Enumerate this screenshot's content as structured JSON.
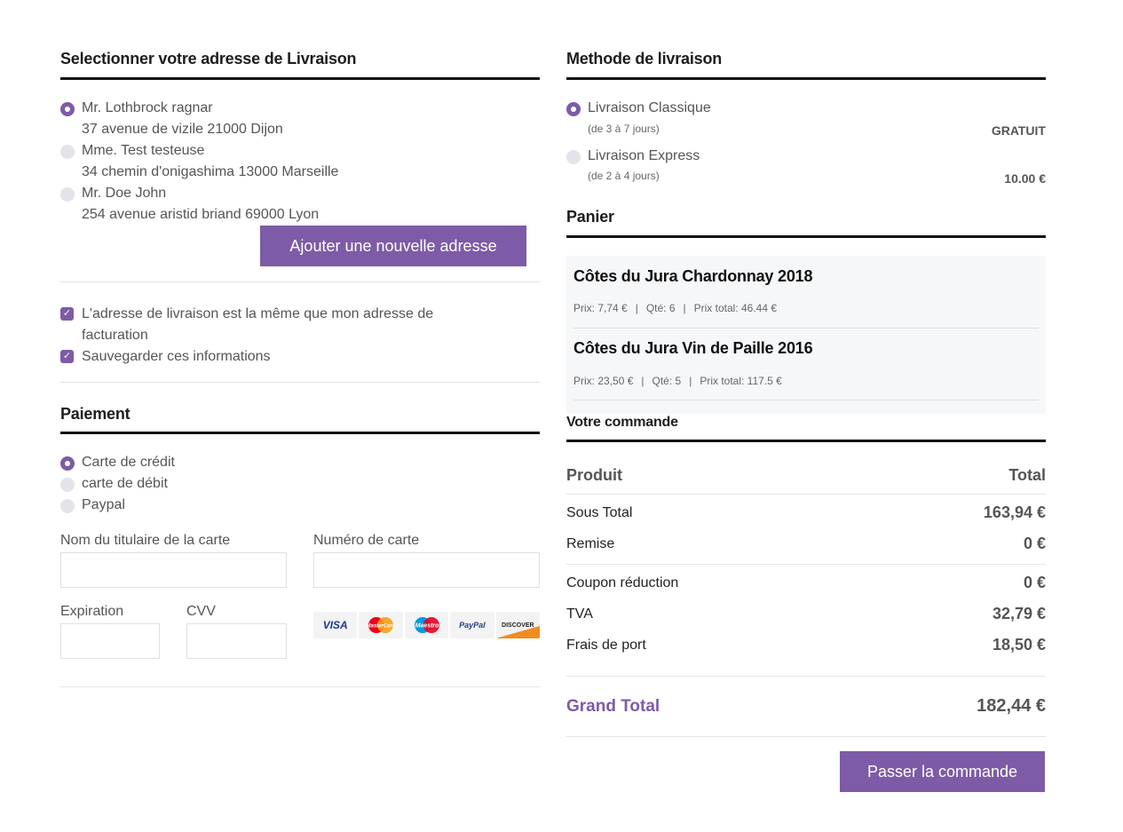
{
  "shipping_address": {
    "title": "Selectionner votre adresse de Livraison",
    "addresses": [
      {
        "name": "Mr. Lothbrock ragnar",
        "line": "37 avenue de vizile 21000 Dijon",
        "selected": true
      },
      {
        "name": "Mme. Test testeuse",
        "line": "34 chemin d'onigashima 13000 Marseille",
        "selected": false
      },
      {
        "name": "Mr. Doe John",
        "line": "254 avenue aristid briand 69000 Lyon",
        "selected": false
      }
    ],
    "add_button": "Ajouter une nouvelle adresse",
    "same_billing_line1": "L'adresse de livraison est la même que mon adresse de",
    "same_billing_line2": "facturation",
    "save_info": "Sauvegarder ces informations"
  },
  "payment": {
    "title": "Paiement",
    "methods": [
      {
        "label": "Carte de crédit",
        "selected": true
      },
      {
        "label": "carte de débit",
        "selected": false
      },
      {
        "label": "Paypal",
        "selected": false
      }
    ],
    "cardholder_label": "Nom du titulaire de la carte",
    "card_number_label": "Numéro de carte",
    "expiration_label": "Expiration",
    "cvv_label": "CVV",
    "card_logos": [
      "VISA",
      "MasterCard",
      "Maestro",
      "PayPal",
      "DISCOVER"
    ]
  },
  "delivery_method": {
    "title": "Methode de livraison",
    "options": [
      {
        "label": "Livraison Classique",
        "detail": "(de 3 à 7 jours)",
        "price": "GRATUIT",
        "selected": true
      },
      {
        "label": "Livraison Express",
        "detail": "(de 2 à 4 jours)",
        "price": "10.00 €",
        "selected": false
      }
    ]
  },
  "cart": {
    "title": "Panier",
    "items": [
      {
        "name": "Côtes du Jura Chardonnay 2018",
        "price": "Prix: 7,74 €",
        "qty": "Qté: 6",
        "total": "Prix total: 46.44 €"
      },
      {
        "name": "Côtes du Jura Vin de Paille 2016",
        "price": "Prix: 23,50 €",
        "qty": "Qté: 5",
        "total": "Prix total: 117.5 €"
      }
    ],
    "separator": "|"
  },
  "order": {
    "title": "Votre commande",
    "col_product": "Produit",
    "col_total": "Total",
    "subtotal_label": "Sous Total",
    "subtotal": "163,94 €",
    "discount_label": "Remise",
    "discount": "0 €",
    "coupon_label": "Coupon réduction",
    "coupon": "0 €",
    "tax_label": "TVA",
    "tax": "32,79 €",
    "shipping_label": "Frais de port",
    "shipping": "18,50 €",
    "grand_total_label": "Grand Total",
    "grand_total": "182,44 €",
    "submit": "Passer la commande"
  },
  "colors": {
    "accent": "#7d5ba6"
  }
}
